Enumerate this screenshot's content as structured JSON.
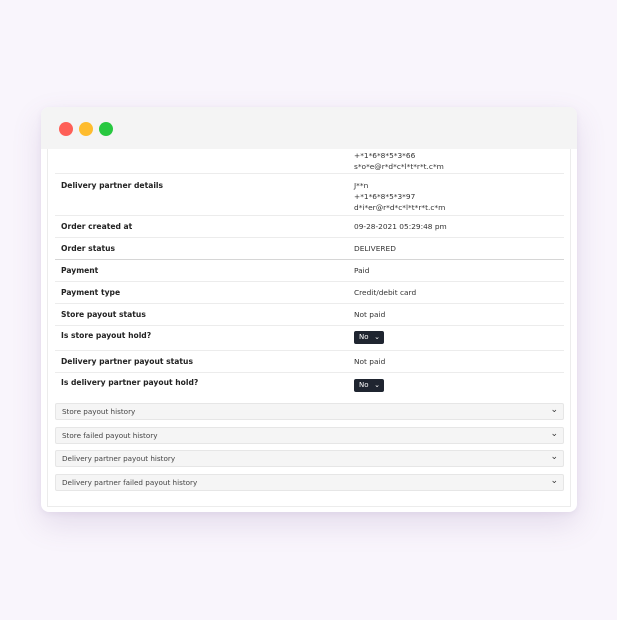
{
  "details": {
    "store_phone": "+*1*6*8*5*3*66",
    "store_email": "s*o*e@r*d*c*l*t*r*t.c*m",
    "delivery_partner_label": "Delivery partner details",
    "delivery_partner_name": "J**n",
    "delivery_partner_phone": "+*1*6*8*5*3*97",
    "delivery_partner_email": "d*i*er@r*d*c*l*t*r*t.c*m",
    "order_created_label": "Order created at",
    "order_created_value": "09-28-2021 05:29:48 pm",
    "order_status_label": "Order status",
    "order_status_value": "DELIVERED",
    "payment_label": "Payment",
    "payment_value": "Paid",
    "payment_type_label": "Payment type",
    "payment_type_value": "Credit/debit card",
    "store_payout_status_label": "Store payout status",
    "store_payout_status_value": "Not paid",
    "store_payout_hold_label": "Is store payout hold?",
    "store_payout_hold_value": "No",
    "dp_payout_status_label": "Delivery partner payout status",
    "dp_payout_status_value": "Not paid",
    "dp_payout_hold_label": "Is delivery partner payout hold?",
    "dp_payout_hold_value": "No"
  },
  "accordions": [
    {
      "label": "Store payout history"
    },
    {
      "label": "Store failed payout history"
    },
    {
      "label": "Delivery partner payout history"
    },
    {
      "label": "Delivery partner failed payout history"
    }
  ],
  "icons": {
    "chevron": "chevron-down-icon"
  },
  "colors": {
    "close": "#fe5f57",
    "minimize": "#febc2e",
    "maximize": "#28c840",
    "select_bg": "#1f2530"
  }
}
